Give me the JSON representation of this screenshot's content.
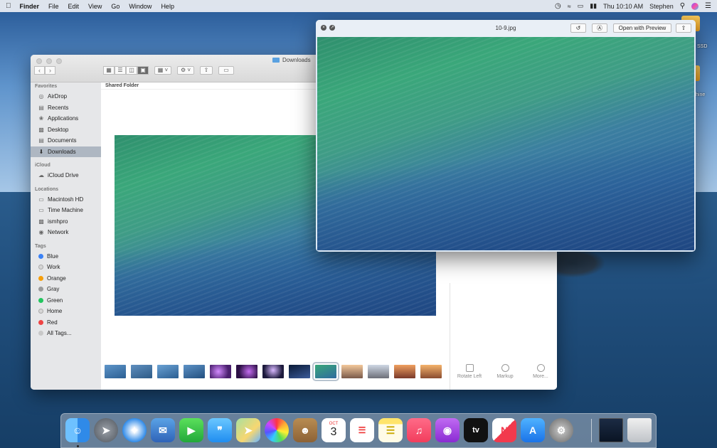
{
  "menubar": {
    "apple": "",
    "items": [
      "Finder",
      "File",
      "Edit",
      "View",
      "Go",
      "Window",
      "Help"
    ],
    "clock": "Thu 10:10 AM",
    "user": "Stephen"
  },
  "desktop": {
    "icon1_label": "SSD",
    "icon2_label": "hine"
  },
  "finder": {
    "title": "Downloads",
    "path_header": "Shared Folder",
    "sidebar": {
      "favorites_header": "Favorites",
      "favorites": [
        {
          "label": "AirDrop",
          "icon": "airdrop-icon"
        },
        {
          "label": "Recents",
          "icon": "recents-icon"
        },
        {
          "label": "Applications",
          "icon": "applications-icon"
        },
        {
          "label": "Desktop",
          "icon": "desktop-icon"
        },
        {
          "label": "Documents",
          "icon": "documents-icon"
        },
        {
          "label": "Downloads",
          "icon": "downloads-icon",
          "selected": true
        }
      ],
      "icloud_header": "iCloud",
      "icloud": [
        {
          "label": "iCloud Drive",
          "icon": "cloud-icon"
        }
      ],
      "locations_header": "Locations",
      "locations": [
        {
          "label": "Macintosh HD",
          "icon": "disk-icon"
        },
        {
          "label": "Time Machine",
          "icon": "disk-icon"
        },
        {
          "label": "ismhpro",
          "icon": "computer-icon"
        },
        {
          "label": "Network",
          "icon": "network-icon"
        }
      ],
      "tags_header": "Tags",
      "tags": [
        {
          "label": "Blue",
          "color": "#3b82f6"
        },
        {
          "label": "Work",
          "color": "#d0d0d0"
        },
        {
          "label": "Orange",
          "color": "#f59e0b"
        },
        {
          "label": "Gray",
          "color": "#9a9a9a"
        },
        {
          "label": "Green",
          "color": "#22c55e"
        },
        {
          "label": "Home",
          "color": "#d0d0d0"
        },
        {
          "label": "Red",
          "color": "#ef4444"
        },
        {
          "label": "All Tags...",
          "color": "#c8c8c8"
        }
      ]
    },
    "actions": [
      {
        "label": "Rotate Left",
        "icon": "rotate-left-icon"
      },
      {
        "label": "Markup",
        "icon": "markup-icon"
      },
      {
        "label": "More...",
        "icon": "more-icon"
      }
    ]
  },
  "quicklook": {
    "title": "10-9.jpg",
    "open_with": "Open with Preview"
  },
  "dock": {
    "calendar_month": "OCT",
    "calendar_day": "3",
    "tv_label": "tv"
  }
}
